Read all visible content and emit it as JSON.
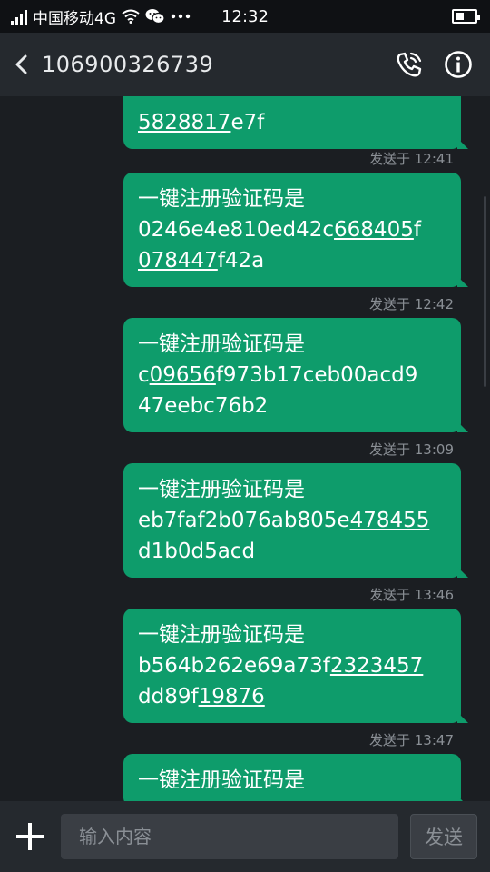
{
  "status": {
    "carrier": "中国移动4G",
    "time": "12:32",
    "icons": [
      "signal-icon",
      "wifi-icon",
      "wechat-icon",
      "more-icon",
      "battery-icon"
    ]
  },
  "header": {
    "title": "106900326739",
    "icons": [
      "back-icon",
      "call-icon",
      "info-icon"
    ]
  },
  "messages": [
    {
      "parts": [
        {
          "t": "5828817",
          "u": true
        },
        {
          "t": "e7f",
          "u": false
        }
      ],
      "time": "发送于 12:41"
    },
    {
      "parts": [
        {
          "t": "一键注册验证码是",
          "u": false,
          "br": true
        },
        {
          "t": "0246e4e810ed42c",
          "u": false
        },
        {
          "t": "668405",
          "u": true
        },
        {
          "t": "f",
          "u": false,
          "br": true
        },
        {
          "t": "078447",
          "u": true
        },
        {
          "t": "f42a",
          "u": false
        }
      ],
      "time": "发送于 12:42"
    },
    {
      "parts": [
        {
          "t": "一键注册验证码是",
          "u": false,
          "br": true
        },
        {
          "t": "c",
          "u": false
        },
        {
          "t": "09656",
          "u": true
        },
        {
          "t": "f973b17ceb00acd9",
          "u": false,
          "br": true
        },
        {
          "t": "47eebc76b2",
          "u": false
        }
      ],
      "time": "发送于 13:09"
    },
    {
      "parts": [
        {
          "t": "一键注册验证码是",
          "u": false,
          "br": true
        },
        {
          "t": "eb7faf2b076ab805e",
          "u": false
        },
        {
          "t": "478455",
          "u": true,
          "br": true
        },
        {
          "t": "d1b0d5acd",
          "u": false
        }
      ],
      "time": "发送于 13:46"
    },
    {
      "parts": [
        {
          "t": "一键注册验证码是",
          "u": false,
          "br": true
        },
        {
          "t": "b564b262e69a73f",
          "u": false
        },
        {
          "t": "2323457",
          "u": true,
          "br": true
        },
        {
          "t": "dd89f",
          "u": false
        },
        {
          "t": "19876",
          "u": true
        }
      ],
      "time": "发送于 13:47"
    },
    {
      "parts": [
        {
          "t": "一键注册验证码是",
          "u": false
        }
      ],
      "time": ""
    }
  ],
  "compose": {
    "placeholder": "输入内容",
    "send_label": "发送"
  },
  "colors": {
    "bubble": "#0e9c6b",
    "background": "#1b1e22",
    "header": "#25292e"
  }
}
